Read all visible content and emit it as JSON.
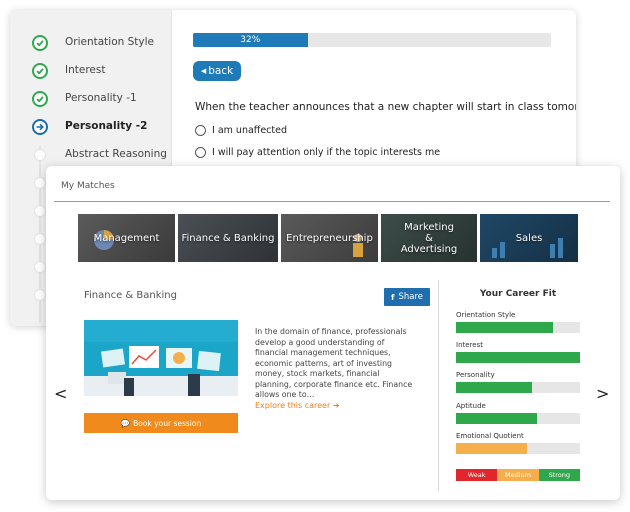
{
  "assessment": {
    "steps": [
      {
        "label": "Orientation Style",
        "state": "done"
      },
      {
        "label": "Interest",
        "state": "done"
      },
      {
        "label": "Personality -1",
        "state": "done"
      },
      {
        "label": "Personality -2",
        "state": "current"
      },
      {
        "label": "Abstract Reasoning",
        "state": "pending"
      }
    ],
    "progress_label": "32%",
    "progress_value": 0.32,
    "back_label": "back",
    "question": "When the teacher announces that a new chapter will start in class tomorrow:",
    "options": [
      "I am unaffected",
      "I will pay attention only if the topic interests me"
    ]
  },
  "matches": {
    "title": "My Matches",
    "categories": [
      {
        "label": "Management",
        "color": "#4a4a4a"
      },
      {
        "label": "Finance & Banking",
        "color": "#3a3f44",
        "selected": true
      },
      {
        "label": "Entrepreneurship",
        "color": "#4d4d4d"
      },
      {
        "label": "Marketing & Advertising",
        "color": "#2f3d3a"
      },
      {
        "label": "Sales",
        "color": "#1d3a52"
      }
    ],
    "detail": {
      "title": "Finance & Banking",
      "share_label": "Share",
      "description": "In the domain of finance, professionals develop a good understanding of financial management techniques, economic patterns, art of investing money, stock markets, financial planning, corporate finance etc. Finance allows one to…",
      "explore_label": "Explore this career",
      "book_label": "Book your session"
    },
    "nav": {
      "prev": "<",
      "next": ">"
    },
    "career_fit": {
      "title": "Your Career Fit",
      "metrics": [
        {
          "label": "Orientation Style",
          "value": 0.78,
          "color": "#2ea84a"
        },
        {
          "label": "Interest",
          "value": 1.0,
          "color": "#2ea84a"
        },
        {
          "label": "Personality",
          "value": 0.61,
          "color": "#2ea84a"
        },
        {
          "label": "Aptitude",
          "value": 0.65,
          "color": "#2ea84a"
        },
        {
          "label": "Emotional Quotient",
          "value": 0.57,
          "color": "#f5ae4c"
        }
      ],
      "legend": [
        {
          "label": "Weak",
          "color": "#e3262b"
        },
        {
          "label": "Medium",
          "color": "#f5ae4c"
        },
        {
          "label": "Strong",
          "color": "#2ea84a"
        }
      ]
    }
  }
}
